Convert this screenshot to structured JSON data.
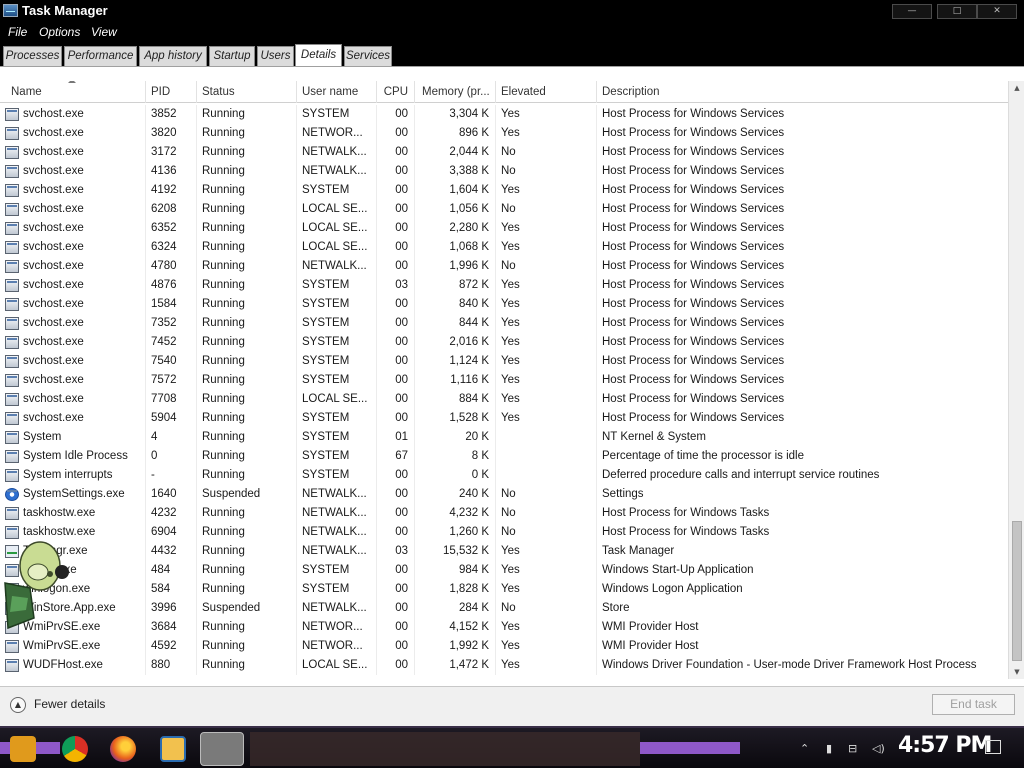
{
  "window": {
    "title": "Task Manager",
    "controls": {
      "minimize": "—",
      "maximize": "□",
      "close": "✕"
    }
  },
  "menu": [
    "File",
    "Options",
    "View"
  ],
  "tabs": [
    "Processes",
    "Performance",
    "App history",
    "Startup",
    "Users",
    "Details",
    "Services"
  ],
  "active_tab": "Details",
  "columns": {
    "name": "Name",
    "pid": "PID",
    "status": "Status",
    "user": "User name",
    "cpu": "CPU",
    "memory": "Memory (pr...",
    "elevated": "Elevated",
    "description": "Description"
  },
  "rows": [
    {
      "icon": "svchost-icon",
      "name": "svchost.exe",
      "pid": "3852",
      "status": "Running",
      "user": "SYSTEM",
      "cpu": "00",
      "memory": "3,304 K",
      "elevated": "Yes",
      "description": "Host Process for Windows Services"
    },
    {
      "icon": "svchost-icon",
      "name": "svchost.exe",
      "pid": "3820",
      "status": "Running",
      "user": "NETWOR...",
      "cpu": "00",
      "memory": "896 K",
      "elevated": "Yes",
      "description": "Host Process for Windows Services"
    },
    {
      "icon": "svchost-icon",
      "name": "svchost.exe",
      "pid": "3172",
      "status": "Running",
      "user": "NETWALK...",
      "cpu": "00",
      "memory": "2,044 K",
      "elevated": "No",
      "description": "Host Process for Windows Services"
    },
    {
      "icon": "svchost-icon",
      "name": "svchost.exe",
      "pid": "4136",
      "status": "Running",
      "user": "NETWALK...",
      "cpu": "00",
      "memory": "3,388 K",
      "elevated": "No",
      "description": "Host Process for Windows Services"
    },
    {
      "icon": "svchost-icon",
      "name": "svchost.exe",
      "pid": "4192",
      "status": "Running",
      "user": "SYSTEM",
      "cpu": "00",
      "memory": "1,604 K",
      "elevated": "Yes",
      "description": "Host Process for Windows Services"
    },
    {
      "icon": "svchost-icon",
      "name": "svchost.exe",
      "pid": "6208",
      "status": "Running",
      "user": "LOCAL SE...",
      "cpu": "00",
      "memory": "1,056 K",
      "elevated": "No",
      "description": "Host Process for Windows Services"
    },
    {
      "icon": "svchost-icon",
      "name": "svchost.exe",
      "pid": "6352",
      "status": "Running",
      "user": "LOCAL SE...",
      "cpu": "00",
      "memory": "2,280 K",
      "elevated": "Yes",
      "description": "Host Process for Windows Services"
    },
    {
      "icon": "svchost-icon",
      "name": "svchost.exe",
      "pid": "6324",
      "status": "Running",
      "user": "LOCAL SE...",
      "cpu": "00",
      "memory": "1,068 K",
      "elevated": "Yes",
      "description": "Host Process for Windows Services"
    },
    {
      "icon": "svchost-icon",
      "name": "svchost.exe",
      "pid": "4780",
      "status": "Running",
      "user": "NETWALK...",
      "cpu": "00",
      "memory": "1,996 K",
      "elevated": "No",
      "description": "Host Process for Windows Services"
    },
    {
      "icon": "svchost-icon",
      "name": "svchost.exe",
      "pid": "4876",
      "status": "Running",
      "user": "SYSTEM",
      "cpu": "03",
      "memory": "872 K",
      "elevated": "Yes",
      "description": "Host Process for Windows Services"
    },
    {
      "icon": "svchost-icon",
      "name": "svchost.exe",
      "pid": "1584",
      "status": "Running",
      "user": "SYSTEM",
      "cpu": "00",
      "memory": "840 K",
      "elevated": "Yes",
      "description": "Host Process for Windows Services"
    },
    {
      "icon": "svchost-icon",
      "name": "svchost.exe",
      "pid": "7352",
      "status": "Running",
      "user": "SYSTEM",
      "cpu": "00",
      "memory": "844 K",
      "elevated": "Yes",
      "description": "Host Process for Windows Services"
    },
    {
      "icon": "svchost-icon",
      "name": "svchost.exe",
      "pid": "7452",
      "status": "Running",
      "user": "SYSTEM",
      "cpu": "00",
      "memory": "2,016 K",
      "elevated": "Yes",
      "description": "Host Process for Windows Services"
    },
    {
      "icon": "svchost-icon",
      "name": "svchost.exe",
      "pid": "7540",
      "status": "Running",
      "user": "SYSTEM",
      "cpu": "00",
      "memory": "1,124 K",
      "elevated": "Yes",
      "description": "Host Process for Windows Services"
    },
    {
      "icon": "svchost-icon",
      "name": "svchost.exe",
      "pid": "7572",
      "status": "Running",
      "user": "SYSTEM",
      "cpu": "00",
      "memory": "1,116 K",
      "elevated": "Yes",
      "description": "Host Process for Windows Services"
    },
    {
      "icon": "svchost-icon",
      "name": "svchost.exe",
      "pid": "7708",
      "status": "Running",
      "user": "LOCAL SE...",
      "cpu": "00",
      "memory": "884 K",
      "elevated": "Yes",
      "description": "Host Process for Windows Services"
    },
    {
      "icon": "svchost-icon",
      "name": "svchost.exe",
      "pid": "5904",
      "status": "Running",
      "user": "SYSTEM",
      "cpu": "00",
      "memory": "1,528 K",
      "elevated": "Yes",
      "description": "Host Process for Windows Services"
    },
    {
      "icon": "system-icon",
      "name": "System",
      "pid": "4",
      "status": "Running",
      "user": "SYSTEM",
      "cpu": "01",
      "memory": "20 K",
      "elevated": "",
      "description": "NT Kernel & System"
    },
    {
      "icon": "system-icon",
      "name": "System Idle Process",
      "pid": "0",
      "status": "Running",
      "user": "SYSTEM",
      "cpu": "67",
      "memory": "8 K",
      "elevated": "",
      "description": "Percentage of time the processor is idle"
    },
    {
      "icon": "system-icon",
      "name": "System interrupts",
      "pid": "-",
      "status": "Running",
      "user": "SYSTEM",
      "cpu": "00",
      "memory": "0 K",
      "elevated": "",
      "description": "Deferred procedure calls and interrupt service routines"
    },
    {
      "icon": "settings-gear-icon",
      "name": "SystemSettings.exe",
      "pid": "1640",
      "status": "Suspended",
      "user": "NETWALK...",
      "cpu": "00",
      "memory": "240 K",
      "elevated": "No",
      "description": "Settings"
    },
    {
      "icon": "taskhost-icon",
      "name": "taskhostw.exe",
      "pid": "4232",
      "status": "Running",
      "user": "NETWALK...",
      "cpu": "00",
      "memory": "4,232 K",
      "elevated": "No",
      "description": "Host Process for Windows Tasks"
    },
    {
      "icon": "taskhost-icon",
      "name": "taskhostw.exe",
      "pid": "6904",
      "status": "Running",
      "user": "NETWALK...",
      "cpu": "00",
      "memory": "1,260 K",
      "elevated": "No",
      "description": "Host Process for Windows Tasks"
    },
    {
      "icon": "task-manager-icon",
      "name": "Taskmgr.exe",
      "pid": "4432",
      "status": "Running",
      "user": "NETWALK...",
      "cpu": "03",
      "memory": "15,532 K",
      "elevated": "Yes",
      "description": "Task Manager"
    },
    {
      "icon": "wininit-icon",
      "name": "wininit.exe",
      "pid": "484",
      "status": "Running",
      "user": "SYSTEM",
      "cpu": "00",
      "memory": "984 K",
      "elevated": "Yes",
      "description": "Windows Start-Up Application"
    },
    {
      "icon": "winlogon-icon",
      "name": "winlogon.exe",
      "pid": "584",
      "status": "Running",
      "user": "SYSTEM",
      "cpu": "00",
      "memory": "1,828 K",
      "elevated": "Yes",
      "description": "Windows Logon Application"
    },
    {
      "icon": "store-icon",
      "name": "WinStore.App.exe",
      "pid": "3996",
      "status": "Suspended",
      "user": "NETWALK...",
      "cpu": "00",
      "memory": "284 K",
      "elevated": "No",
      "description": "Store"
    },
    {
      "icon": "wmi-icon",
      "name": "WmiPrvSE.exe",
      "pid": "3684",
      "status": "Running",
      "user": "NETWOR...",
      "cpu": "00",
      "memory": "4,152 K",
      "elevated": "Yes",
      "description": "WMI Provider Host"
    },
    {
      "icon": "wmi-icon",
      "name": "WmiPrvSE.exe",
      "pid": "4592",
      "status": "Running",
      "user": "NETWOR...",
      "cpu": "00",
      "memory": "1,992 K",
      "elevated": "Yes",
      "description": "WMI Provider Host"
    },
    {
      "icon": "wudf-icon",
      "name": "WUDFHost.exe",
      "pid": "880",
      "status": "Running",
      "user": "LOCAL SE...",
      "cpu": "00",
      "memory": "1,472 K",
      "elevated": "Yes",
      "description": "Windows Driver Foundation - User-mode Driver Framework Host Process"
    }
  ],
  "footer": {
    "fewer_details": "Fewer details",
    "end_task": "End task"
  },
  "taskbar": {
    "clock": "4:57 PM",
    "icons": [
      "start-icon",
      "chrome-icon",
      "firefox-icon",
      "file-explorer-icon",
      "task-manager-icon"
    ]
  },
  "colors": {
    "title_bar": "#000000",
    "window_bg": "#ffffff",
    "taskbar_accent": "#8e58c8"
  }
}
